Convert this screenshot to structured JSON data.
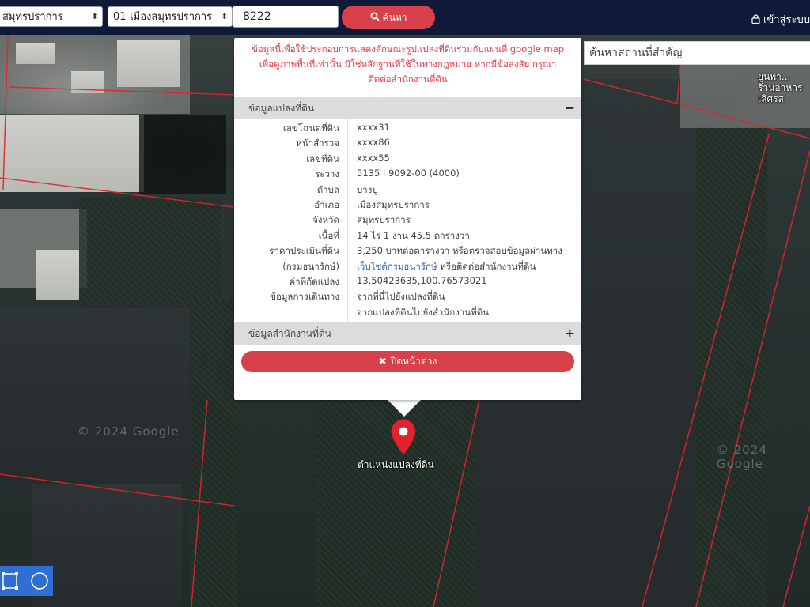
{
  "topbar": {
    "province_select": "สมุทรปราการ",
    "district_select": "01-เมืองสมุทรปราการ",
    "parcel_number_value": "8222",
    "search_button_label": "ค้นหา",
    "login_label": "เข้าสู่ระบบ"
  },
  "landmark_search": {
    "placeholder": "ค้นหาสถานที่สำคัญ"
  },
  "map": {
    "watermark_left": "© 2024 Google",
    "watermark_right": "© 2024 Google",
    "place_label": "ยูนพา... ร้านอาหารเลิศรส",
    "marker_label": "ตำแหน่งแปลงที่ดิน"
  },
  "popup": {
    "disclaimer_line1": "ข้อมูลนี้เพื่อใช้ประกอบการแสดงลักษณะรูปแปลงที่ดินร่วมกับแผนที่ google map",
    "disclaimer_line2": "เพื่อดูภาพพื้นที่เท่านั้น มิใช่หลักฐานที่ใช้ในทางกฎหมาย หากมีข้อสงสัย กรุณา",
    "disclaimer_line3": "ติดต่อสำนักงานที่ดิน",
    "section_parcel_title": "ข้อมูลแปลงที่ดิน",
    "section_parcel_toggle": "−",
    "section_office_title": "ข้อมูลสำนักงานที่ดิน",
    "section_office_toggle": "+",
    "close_button_label": "ปิดหน้าต่าง",
    "rows": [
      {
        "label": "เลขโฉนดที่ดิน",
        "value": "xxxx31"
      },
      {
        "label": "หน้าสำรวจ",
        "value": "xxxx86"
      },
      {
        "label": "เลขที่ดิน",
        "value": "xxxx55"
      },
      {
        "label": "ระวาง",
        "value": "5135 I 9092-00 (4000)"
      },
      {
        "label": "ตำบล",
        "value": "บางปู"
      },
      {
        "label": "อำเภอ",
        "value": "เมืองสมุทรปราการ"
      },
      {
        "label": "จังหวัด",
        "value": "สมุทรปราการ"
      },
      {
        "label": "เนื้อที่",
        "value": "14 ไร่ 1 งาน 45.5 ตารางวา"
      },
      {
        "label": "ราคาประเมินที่ดิน",
        "value": "3,250 บาทต่อตารางวา หรือตรวจสอบข้อมูลผ่านทาง"
      },
      {
        "label": "(กรมธนารักษ์)",
        "value_link": "เว็บไซต์กรมธนารักษ์",
        "value_rest": " หรือติดต่อสำนักงานที่ดิน"
      },
      {
        "label": "ค่าพิกัดแปลง",
        "value_link": "13.50423635,100.76573021"
      },
      {
        "label": "ข้อมูลการเดินทาง",
        "value_link": "จากที่นี่ไปยังแปลงที่ดิน"
      },
      {
        "label": "",
        "value_link": "จากแปลงที่ดินไปยังสำนักงานที่ดิน"
      }
    ]
  },
  "icons": {
    "search": "search-icon",
    "lock": "lock-icon",
    "close": "close-icon",
    "marker": "map-marker-icon",
    "rect_tool": "draw-rectangle-icon",
    "circle_tool": "draw-circle-icon"
  },
  "colors": {
    "topbar_bg": "#0e1a38",
    "accent_red": "#d9414a",
    "disclaimer_red": "#e0424f",
    "link_blue": "#3b62b5",
    "parcel_line": "#e0242f",
    "tool_blue": "#2f6fd3"
  }
}
